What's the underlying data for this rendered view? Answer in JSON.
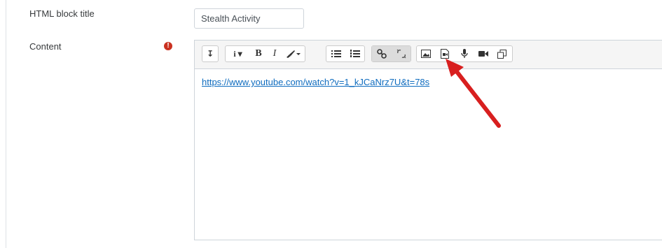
{
  "form": {
    "title_label": "HTML block title",
    "title_value": "Stealth Activity",
    "content_label": "Content",
    "required_icon": "exclamation-circle-icon",
    "required_symbol": "!"
  },
  "toolbar": {
    "toggle_symbol": "↧",
    "info_symbol": "i ▾",
    "bold_symbol": "B",
    "italic_symbol": "I",
    "brush_symbol": "🖌▾",
    "icons": [
      "collapse-toggle-icon",
      "info-dropdown-icon",
      "bold-icon",
      "italic-icon",
      "text-style-icon",
      "unordered-list-icon",
      "ordered-list-icon",
      "link-icon",
      "unlink-icon",
      "insert-image-icon",
      "insert-media-icon",
      "record-audio-icon",
      "record-video-icon",
      "manage-files-icon"
    ]
  },
  "editor": {
    "content_text": "https://www.youtube.com/watch?v=1_kJCaNrz7U&t=78s"
  },
  "colors": {
    "arrow": "#d81f1f",
    "link": "#0f6cbf",
    "required": "#ca3120"
  }
}
